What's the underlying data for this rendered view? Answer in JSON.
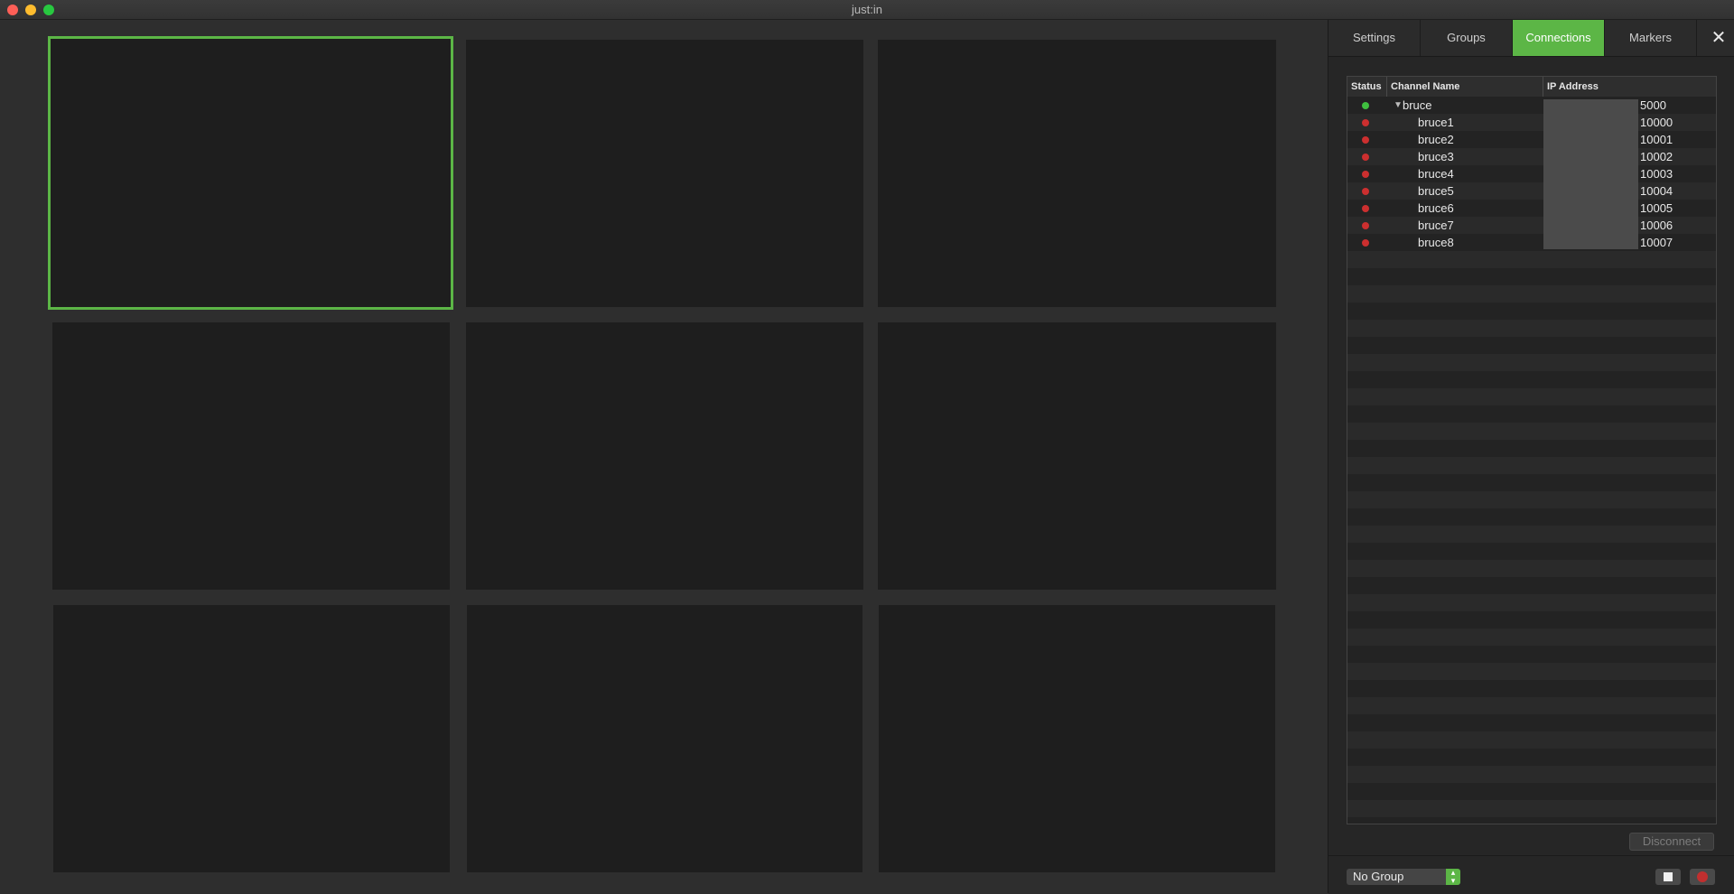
{
  "window": {
    "title": "just:in"
  },
  "tabs": [
    {
      "label": "Settings",
      "active": false
    },
    {
      "label": "Groups",
      "active": false
    },
    {
      "label": "Connections",
      "active": true
    },
    {
      "label": "Markers",
      "active": false
    }
  ],
  "close_glyph": "✕",
  "table": {
    "headers": [
      "Status",
      "Channel Name",
      "IP Address"
    ],
    "rows": [
      {
        "status": "green",
        "name": "bruce",
        "port": "5000",
        "expanded": true,
        "level": 0
      },
      {
        "status": "red",
        "name": "bruce1",
        "port": "10000",
        "level": 1
      },
      {
        "status": "red",
        "name": "bruce2",
        "port": "10001",
        "level": 1
      },
      {
        "status": "red",
        "name": "bruce3",
        "port": "10002",
        "level": 1
      },
      {
        "status": "red",
        "name": "bruce4",
        "port": "10003",
        "level": 1
      },
      {
        "status": "red",
        "name": "bruce5",
        "port": "10004",
        "level": 1
      },
      {
        "status": "red",
        "name": "bruce6",
        "port": "10005",
        "level": 1
      },
      {
        "status": "red",
        "name": "bruce7",
        "port": "10006",
        "level": 1
      },
      {
        "status": "red",
        "name": "bruce8",
        "port": "10007",
        "level": 1
      }
    ]
  },
  "disconnect_label": "Disconnect",
  "group_select": {
    "value": "No Group"
  },
  "colors": {
    "accent": "#5cb646",
    "status_green": "#3fbf3f",
    "status_red": "#cc2f2f"
  },
  "icons": {
    "expand": "triangle-down-icon",
    "stop": "stop-icon",
    "record": "record-icon"
  }
}
